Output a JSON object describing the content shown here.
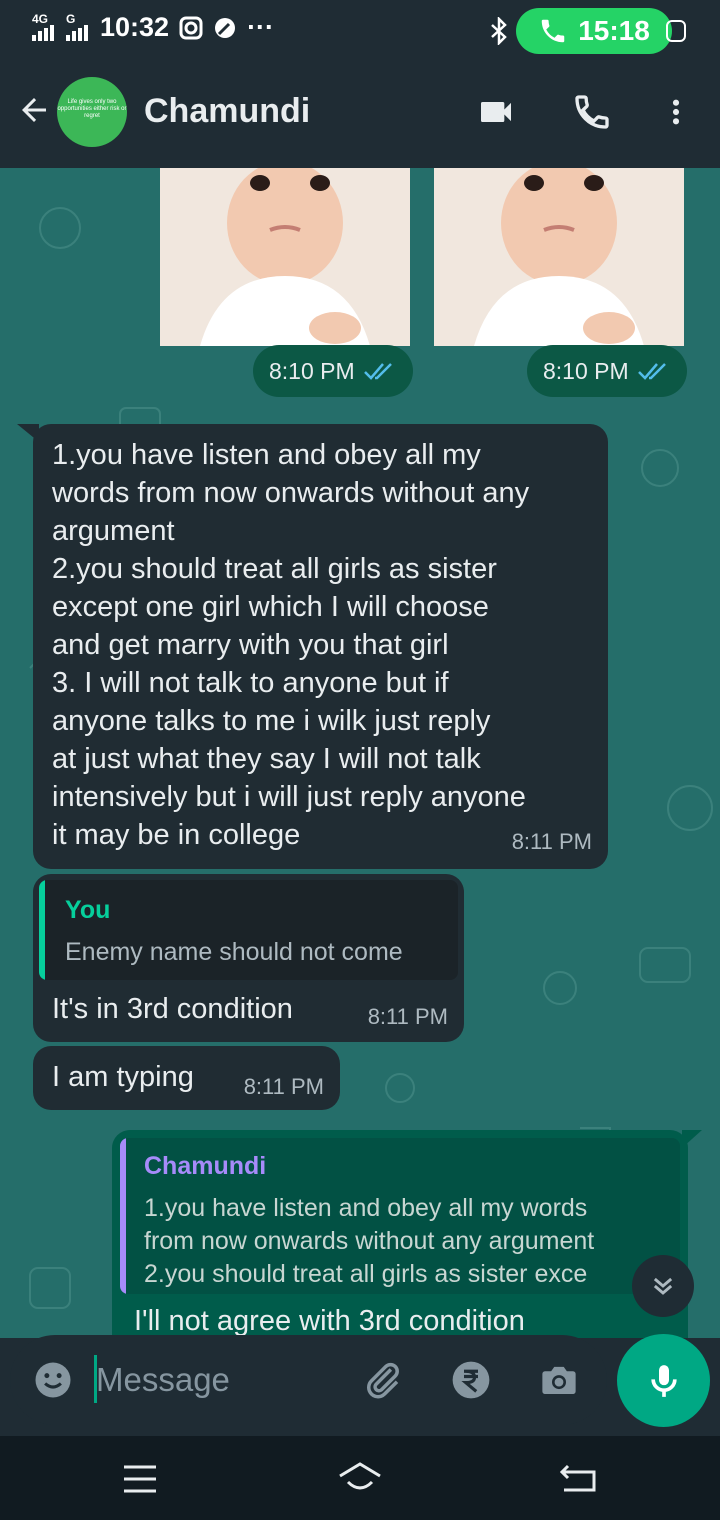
{
  "status_bar": {
    "network_label_1": "4G",
    "network_label_2": "G",
    "clock": "10:32",
    "more": "···",
    "call_timer": "15:18"
  },
  "header": {
    "contact_name": "Chamundi",
    "avatar_text": "Life gives only two opportunities either risk or regret"
  },
  "messages": {
    "img1_time": "8:10 PM",
    "img2_time": "8:10 PM",
    "m1_text": "1.you have listen and obey all my\nwords from now onwards without any\nargument\n2.you should treat all girls as sister\nexcept one girl which I will choose\nand get marry with you that girl\n3. I will not talk to anyone but if\nanyone talks to me i wilk just reply\nat just what they say I will not talk\nintensively but i will just reply anyone\nit may be in college",
    "m1_time": "8:11 PM",
    "m2_quote_author": "You",
    "m2_quote_text": "Enemy name should not come",
    "m2_text": "It's in 3rd condition",
    "m2_time": "8:11 PM",
    "m3_text": "I am typing",
    "m3_time": "8:11 PM",
    "m4_quote_author": "Chamundi",
    "m4_quote_text": "1.you have listen and obey all my words\nfrom now onwards without any argument\n2.you should treat all girls as sister exce",
    "m4_text": "I'll not agree with 3rd condition"
  },
  "input": {
    "placeholder": "Message"
  },
  "colors": {
    "chat_bg": "#256e6a",
    "incoming_bubble": "#202c33",
    "outgoing_bubble": "#005c4b",
    "accent": "#00a884",
    "read_ticks": "#53bdeb",
    "you_quote": "#06cf9c",
    "contact_quote": "#a78bfa"
  },
  "icons": {
    "back": "arrow-left-icon",
    "video": "video-call-icon",
    "call": "phone-icon",
    "menu": "more-vert-icon",
    "emoji": "emoji-icon",
    "attach": "paperclip-icon",
    "payment": "rupee-icon",
    "camera": "camera-icon",
    "mic": "mic-icon",
    "scroll": "double-chevron-down-icon"
  }
}
